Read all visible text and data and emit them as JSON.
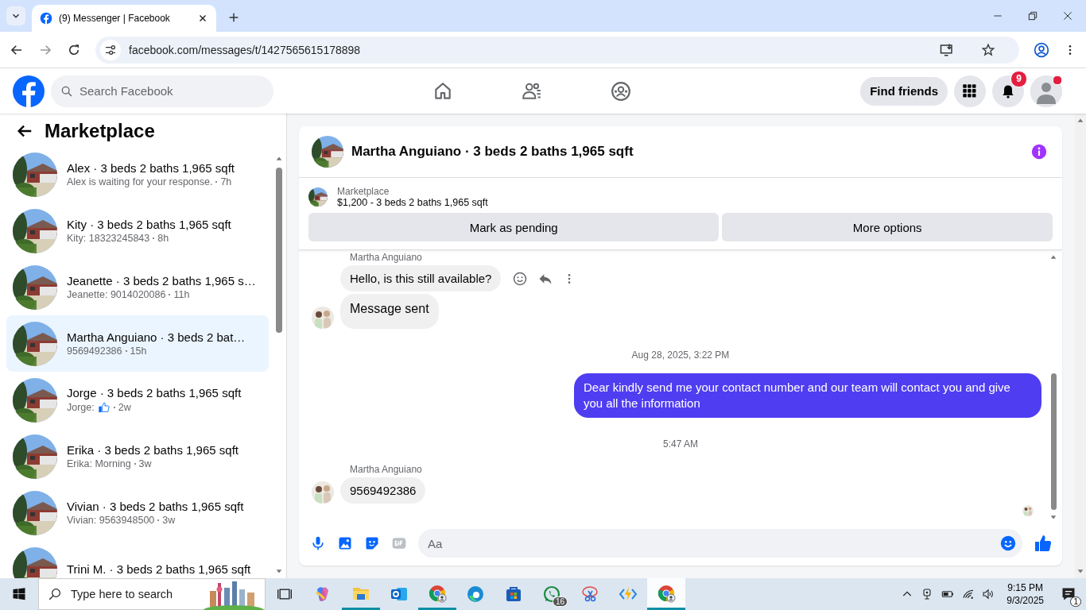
{
  "browser": {
    "tab_title": "(9) Messenger | Facebook",
    "url": "facebook.com/messages/t/1427565615178898"
  },
  "header": {
    "search_placeholder": "Search Facebook",
    "find_friends": "Find friends",
    "notification_count": "9",
    "profile_dot": true
  },
  "sidebar": {
    "title": "Marketplace",
    "conversations": [
      {
        "title": "Alex · 3 beds 2 baths 1,965 sqft",
        "kind": "text",
        "preview": "Alex is waiting for your response.",
        "time": "7h",
        "selected": false
      },
      {
        "title": "Kity · 3 beds 2 baths 1,965 sqft",
        "kind": "text",
        "preview": "Kity: 18323245843",
        "time": "8h",
        "selected": false
      },
      {
        "title": "Jeanette · 3 beds 2 baths 1,965 s…",
        "kind": "text",
        "preview": "Jeanette: 9014020086",
        "time": "11h",
        "selected": false
      },
      {
        "title": "Martha Anguiano · 3 beds 2 bat…",
        "kind": "text",
        "preview": "9569492386",
        "time": "15h",
        "selected": true
      },
      {
        "title": "Jorge · 3 beds 2 baths 1,965 sqft",
        "kind": "like",
        "preview": "Jorge:",
        "time": "2w",
        "selected": false
      },
      {
        "title": "Erika · 3 beds 2 baths 1,965 sqft",
        "kind": "text",
        "preview": "Erika: Morning",
        "time": "3w",
        "selected": false
      },
      {
        "title": "Vivian · 3 beds 2 baths 1,965 sqft",
        "kind": "text",
        "preview": "Vivian: 9563948500",
        "time": "3w",
        "selected": false
      },
      {
        "title": "Trini M. · 3 beds 2 baths 1,965 sqft",
        "kind": "cut",
        "selected": false
      }
    ]
  },
  "chat": {
    "title": "Martha Anguiano · 3 beds 2 baths 1,965 sqft",
    "listing": {
      "label": "Marketplace",
      "detail": "$1,200 - 3 beds 2 baths 1,965 sqft"
    },
    "buttons": [
      "Mark as pending",
      "More options"
    ],
    "messages": [
      {
        "kind": "sender",
        "text": "Martha Anguiano"
      },
      {
        "kind": "incoming",
        "text": "Hello, is this still available?",
        "avatar": false,
        "actions": true,
        "emphasized": false
      },
      {
        "kind": "incoming",
        "text": "Message sent",
        "avatar": true,
        "actions": false,
        "emphasized": true
      },
      {
        "kind": "timestamp",
        "text": "Aug 28, 2025, 3:22 PM"
      },
      {
        "kind": "outgoing",
        "text": "Dear kindly send me your contact number and our team will contact you and give you all the information"
      },
      {
        "kind": "timestamp",
        "text": "5:47 AM"
      },
      {
        "kind": "sender",
        "text": "Martha Anguiano"
      },
      {
        "kind": "incoming",
        "text": "9569492386",
        "avatar": true,
        "actions": false,
        "emphasized": false
      },
      {
        "kind": "seen"
      }
    ],
    "composer_placeholder": "Aa"
  },
  "taskbar": {
    "search_placeholder": "Type here to search",
    "apps": [
      {
        "kind": "copilot",
        "running": false,
        "active": false
      },
      {
        "kind": "files",
        "running": true,
        "active": false
      },
      {
        "kind": "outlook",
        "running": false,
        "active": false
      },
      {
        "kind": "chrome",
        "running": true,
        "active": false
      },
      {
        "kind": "edge",
        "running": false,
        "active": false
      },
      {
        "kind": "store",
        "running": false,
        "active": false
      },
      {
        "kind": "whatsapp",
        "running": false,
        "active": false,
        "badge": "16"
      },
      {
        "kind": "snip",
        "running": false,
        "active": false
      },
      {
        "kind": "power",
        "running": false,
        "active": false
      },
      {
        "kind": "chrome",
        "running": true,
        "active": true
      }
    ],
    "time": "9:15 PM",
    "date": "9/3/2025",
    "notification_count": "1"
  }
}
